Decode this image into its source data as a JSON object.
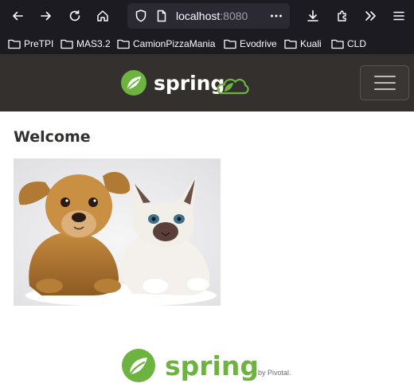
{
  "browser": {
    "url_host": "localhost",
    "url_port": ":8080",
    "bookmarks": [
      "PreTPI",
      "MAS3.2",
      "CamionPizzaMania",
      "Evodrive",
      "Kuali",
      "CLD"
    ]
  },
  "navbar": {
    "brand_text": "spring"
  },
  "main": {
    "heading": "Welcome"
  },
  "footer": {
    "brand_text": "spring",
    "by_text": "by Pivotal."
  },
  "colors": {
    "spring_green": "#6db33f",
    "navbar_bg": "#34302d",
    "heading": "#34302d"
  }
}
